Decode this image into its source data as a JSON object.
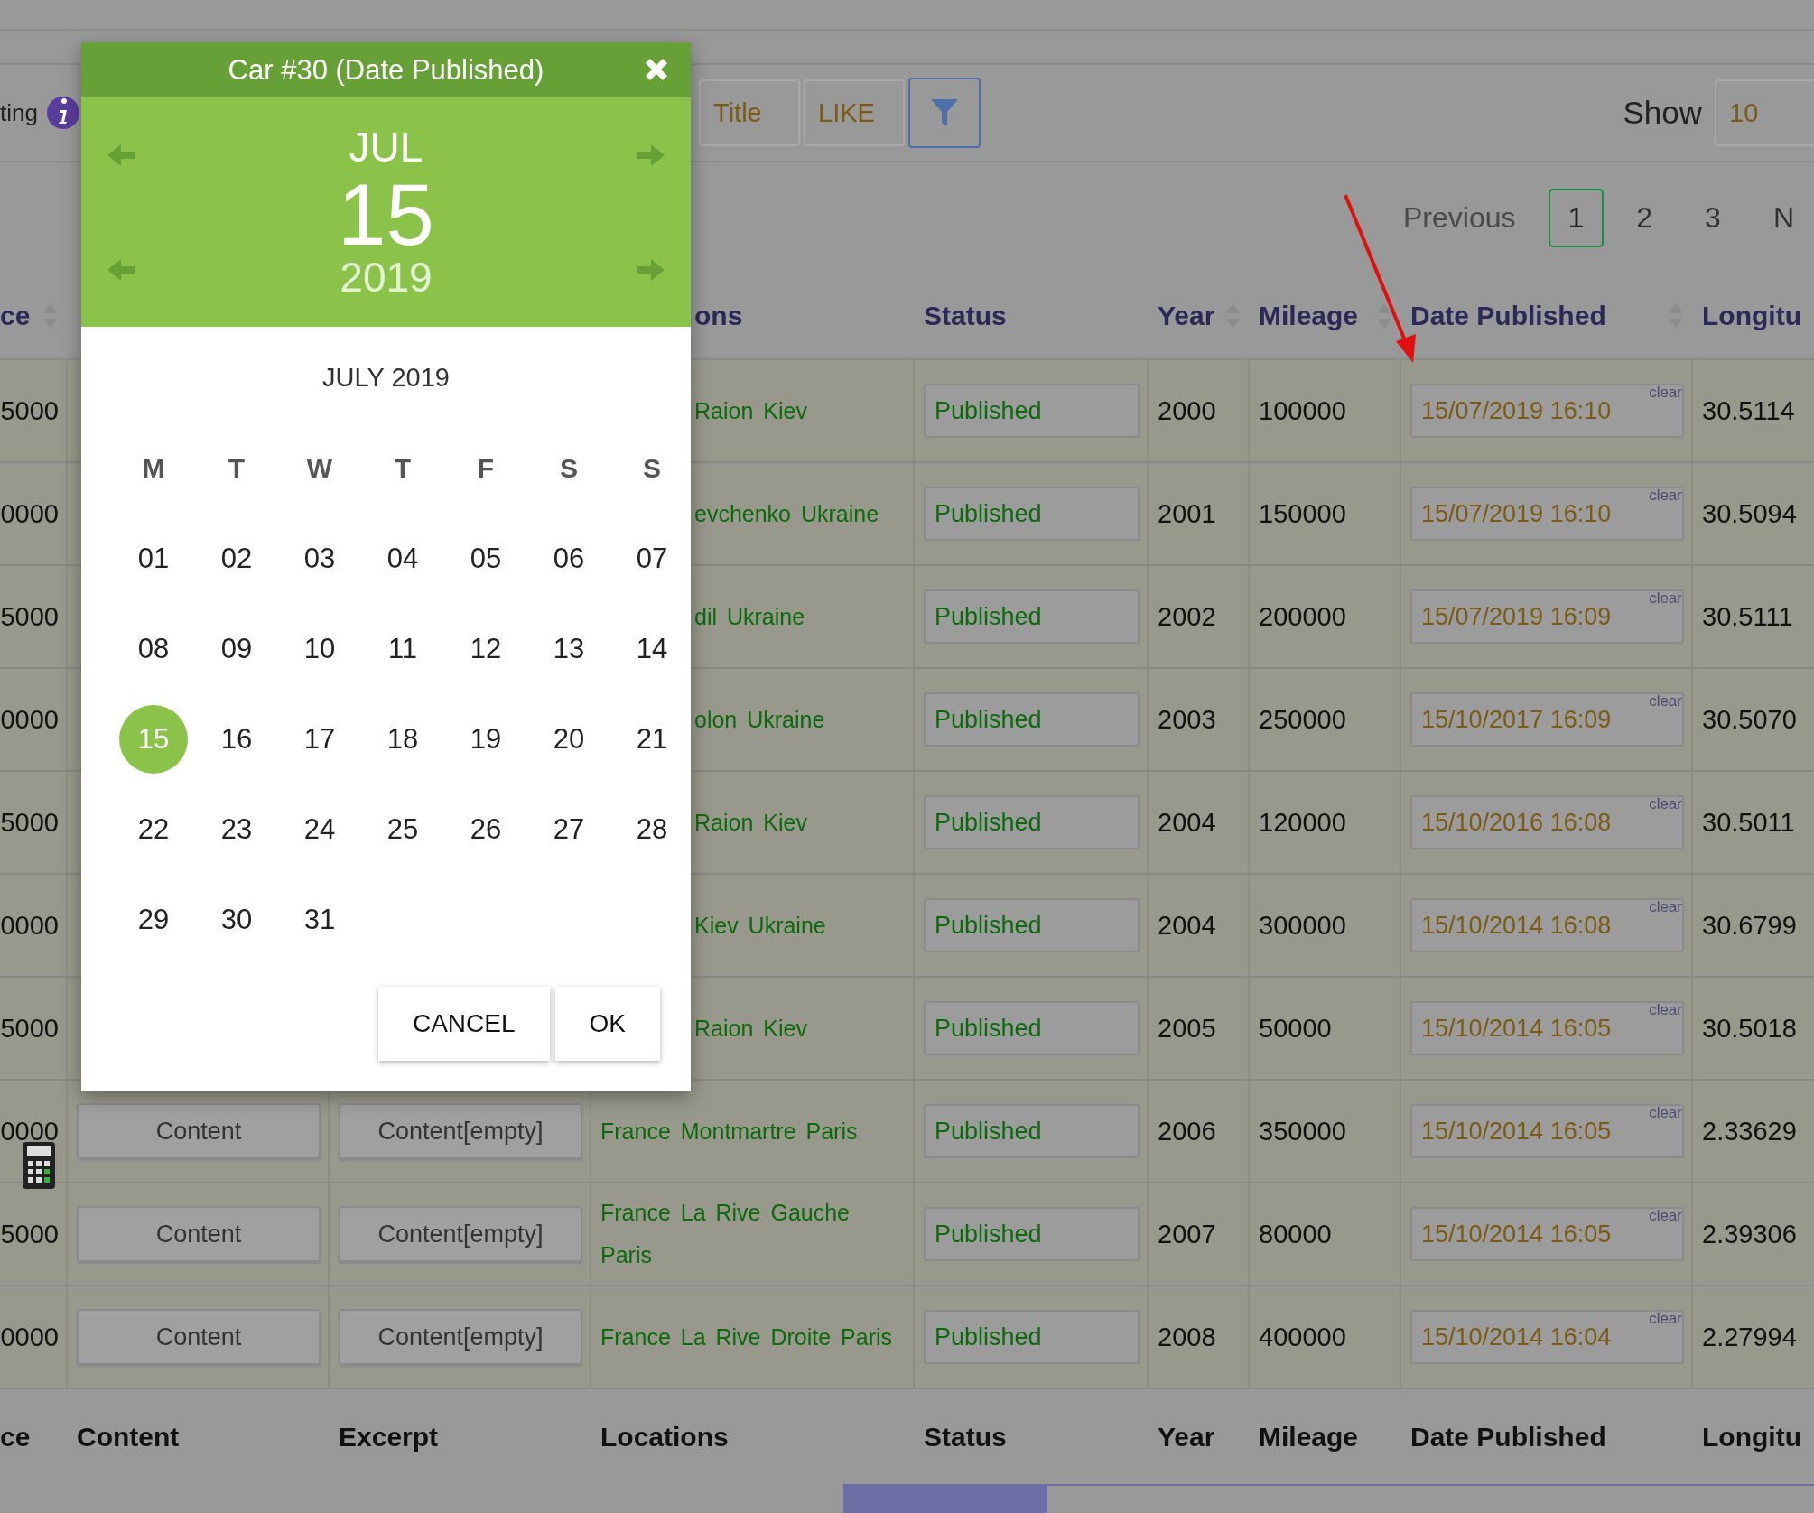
{
  "toolbar": {
    "label": "ting",
    "filter_field": "Title",
    "operator_field": "LIKE",
    "show_label": "Show",
    "show_field": "10"
  },
  "pagination": [
    {
      "label": "Previous",
      "selected": false
    },
    {
      "label": "1",
      "selected": true
    },
    {
      "label": "2",
      "selected": false
    },
    {
      "label": "3",
      "selected": false
    },
    {
      "label": "N",
      "selected": false
    }
  ],
  "table": {
    "columns": [
      {
        "label": "ce",
        "sortable": true
      },
      {
        "label": "ons",
        "sortable": false
      },
      {
        "label": "Status",
        "sortable": false
      },
      {
        "label": "Year",
        "sortable": true
      },
      {
        "label": "Mileage",
        "sortable": true
      },
      {
        "label": "Date Published",
        "sortable": true
      },
      {
        "label": "Longitu",
        "sortable": false
      }
    ],
    "rows": [
      {
        "price": "5000",
        "location": "Raion Kiev",
        "status": "Published",
        "year": "2000",
        "mileage": "100000",
        "date": "15/07/2019 16:10",
        "clear": "clear",
        "longitude": "30.5114"
      },
      {
        "price": "0000",
        "location": "evchenko Ukraine",
        "status": "Published",
        "year": "2001",
        "mileage": "150000",
        "date": "15/07/2019 16:10",
        "clear": "clear",
        "longitude": "30.5094"
      },
      {
        "price": "5000",
        "location": "dil Ukraine",
        "status": "Published",
        "year": "2002",
        "mileage": "200000",
        "date": "15/07/2019 16:09",
        "clear": "clear",
        "longitude": "30.5111"
      },
      {
        "price": "0000",
        "location": "olon Ukraine",
        "status": "Published",
        "year": "2003",
        "mileage": "250000",
        "date": "15/10/2017 16:09",
        "clear": "clear",
        "longitude": "30.5070"
      },
      {
        "price": "5000",
        "location": "Raion Kiev",
        "status": "Published",
        "year": "2004",
        "mileage": "120000",
        "date": "15/10/2016 16:08",
        "clear": "clear",
        "longitude": "30.5011"
      },
      {
        "price": "0000",
        "location": "Kiev Ukraine",
        "status": "Published",
        "year": "2004",
        "mileage": "300000",
        "date": "15/10/2014 16:08",
        "clear": "clear",
        "longitude": "30.6799"
      },
      {
        "price": "5000",
        "location": "Raion Kiev",
        "status": "Published",
        "year": "2005",
        "mileage": "50000",
        "date": "15/10/2014 16:05",
        "clear": "clear",
        "longitude": "30.5018"
      },
      {
        "price": "0000",
        "content": "Content",
        "excerpt": "Content[empty]",
        "location": "France  Montmartre  Paris",
        "status": "Published",
        "year": "2006",
        "mileage": "350000",
        "date": "15/10/2014 16:05",
        "clear": "clear",
        "longitude": "2.33629"
      },
      {
        "price": "5000",
        "content": "Content",
        "excerpt": "Content[empty]",
        "location": "France  La Rive Gauche Paris",
        "status": "Published",
        "year": "2007",
        "mileage": "80000",
        "date": "15/10/2014 16:05",
        "clear": "clear",
        "longitude": "2.39306"
      },
      {
        "price": "0000",
        "content": "Content",
        "excerpt": "Content[empty]",
        "location": "France  La Rive Droite Paris",
        "status": "Published",
        "year": "2008",
        "mileage": "400000",
        "date": "15/10/2014 16:04",
        "clear": "clear",
        "longitude": "2.27994"
      }
    ],
    "footer": [
      "ce",
      "Content",
      "Excerpt",
      "Locations",
      "Status",
      "Year",
      "Mileage",
      "Date Published",
      "Longitu"
    ]
  },
  "date_picker": {
    "title": "Car #30 (Date Published)",
    "month": "JUL",
    "day": "15",
    "year": "2019",
    "calendar_title": "JULY 2019",
    "weekdays": [
      "M",
      "T",
      "W",
      "T",
      "F",
      "S",
      "S"
    ],
    "days": [
      {
        "label": "01",
        "selected": false
      },
      {
        "label": "02",
        "selected": false
      },
      {
        "label": "03",
        "selected": false
      },
      {
        "label": "04",
        "selected": false
      },
      {
        "label": "05",
        "selected": false
      },
      {
        "label": "06",
        "selected": false
      },
      {
        "label": "07",
        "selected": false
      },
      {
        "label": "08",
        "selected": false
      },
      {
        "label": "09",
        "selected": false
      },
      {
        "label": "10",
        "selected": false
      },
      {
        "label": "11",
        "selected": false
      },
      {
        "label": "12",
        "selected": false
      },
      {
        "label": "13",
        "selected": false
      },
      {
        "label": "14",
        "selected": false
      },
      {
        "label": "15",
        "selected": true
      },
      {
        "label": "16",
        "selected": false
      },
      {
        "label": "17",
        "selected": false
      },
      {
        "label": "18",
        "selected": false
      },
      {
        "label": "19",
        "selected": false
      },
      {
        "label": "20",
        "selected": false
      },
      {
        "label": "21",
        "selected": false
      },
      {
        "label": "22",
        "selected": false
      },
      {
        "label": "23",
        "selected": false
      },
      {
        "label": "24",
        "selected": false
      },
      {
        "label": "25",
        "selected": false
      },
      {
        "label": "26",
        "selected": false
      },
      {
        "label": "27",
        "selected": false
      },
      {
        "label": "28",
        "selected": false
      },
      {
        "label": "29",
        "selected": false
      },
      {
        "label": "30",
        "selected": false
      },
      {
        "label": "31",
        "selected": false
      }
    ],
    "buttons": [
      "CANCEL",
      "OK"
    ]
  }
}
